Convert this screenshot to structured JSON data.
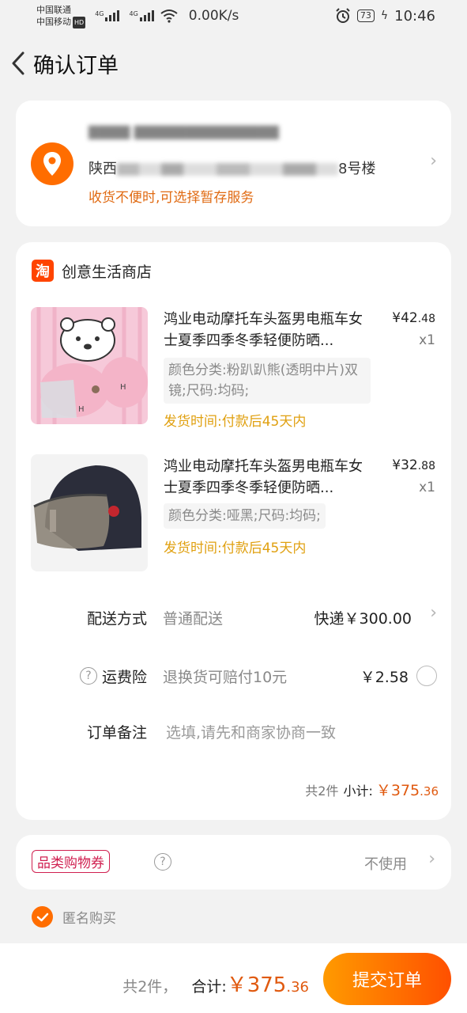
{
  "status": {
    "carrier1": "中国联通",
    "carrier2": "中国移动",
    "hd": "HD",
    "net1": "4G",
    "net2": "4G",
    "speed": "0.00K/s",
    "battery": "73",
    "time": "10:46"
  },
  "header": {
    "title": "确认订单"
  },
  "address": {
    "line_prefix": "陕西",
    "line_suffix": "8号楼",
    "hint": "收货不便时,可选择暂存服务"
  },
  "shop": {
    "logo_text": "淘",
    "name": "创意生活商店"
  },
  "items": [
    {
      "title": "鸿业电动摩托车头盔男电瓶车女士夏季四季冬季轻便防晒...",
      "price_int": "¥42",
      "price_dec": ".48",
      "qty": "x1",
      "spec": "颜色分类:粉趴趴熊(透明中片)双镜;尺码:均码;",
      "ship": "发货时间:付款后45天内"
    },
    {
      "title": "鸿业电动摩托车头盔男电瓶车女士夏季四季冬季轻便防晒...",
      "price_int": "¥32",
      "price_dec": ".88",
      "qty": "x1",
      "spec": "颜色分类:哑黑;尺码:均码;",
      "ship": "发货时间:付款后45天内"
    }
  ],
  "delivery": {
    "label": "配送方式",
    "value": "普通配送",
    "right": "快递￥300.00"
  },
  "insurance": {
    "label": "运费险",
    "value": "退换货可赔付10元",
    "right": "￥2.58"
  },
  "remark": {
    "label": "订单备注",
    "placeholder": "选填,请先和商家协商一致"
  },
  "subtotal": {
    "count": "共2件",
    "label": "小计:",
    "int": "￥375",
    "dec": ".36"
  },
  "coupon": {
    "tag": "品类购物券",
    "value": "不使用"
  },
  "anonymous": {
    "label": "匿名购买"
  },
  "footer": {
    "count": "共2件，",
    "label": "合计:",
    "int": "￥375",
    "dec": ".36",
    "submit": "提交订单"
  },
  "colors": {
    "accent": "#ff6d00",
    "price": "#e05a10",
    "ship": "#e0a010",
    "coupon": "#d02050"
  }
}
